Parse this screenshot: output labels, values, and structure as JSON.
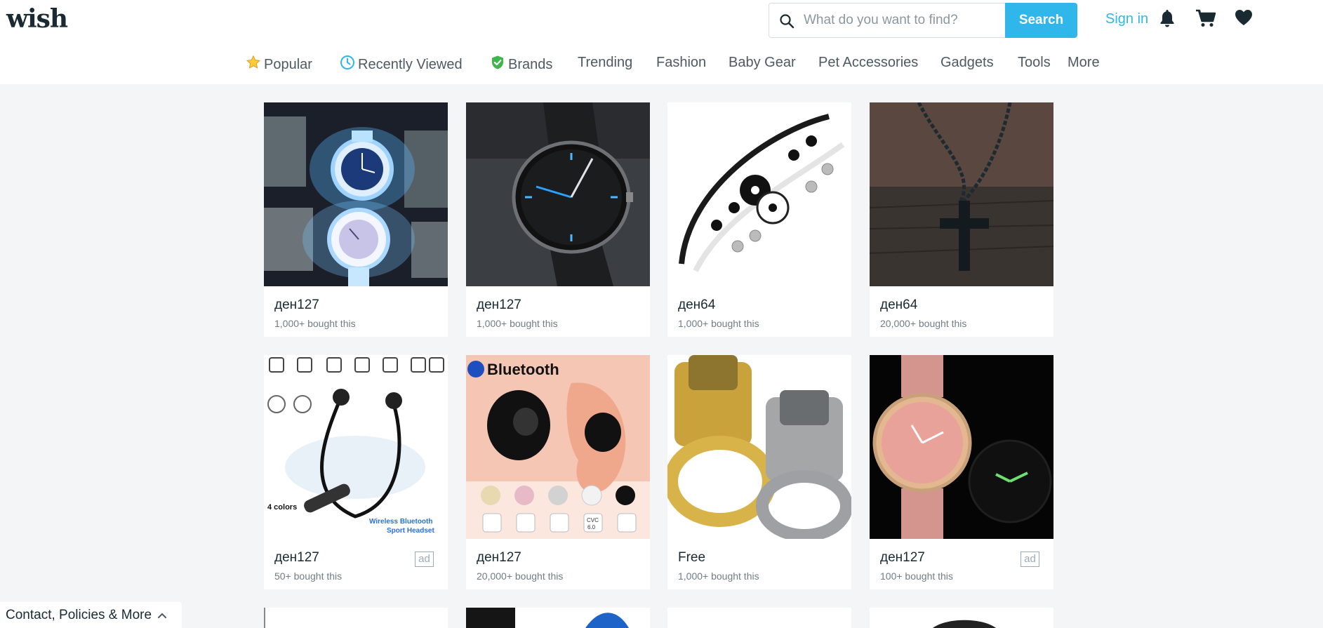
{
  "header": {
    "logo": "wish",
    "search_placeholder": "What do you want to find?",
    "search_button": "Search",
    "sign_in": "Sign in",
    "icons": [
      "bell-icon",
      "cart-icon",
      "heart-icon"
    ]
  },
  "nav": {
    "items": [
      {
        "label": "Popular",
        "icon": "star-icon"
      },
      {
        "label": "Recently Viewed",
        "icon": "clock-icon"
      },
      {
        "label": "Brands",
        "icon": "shield-check-icon"
      },
      {
        "label": "Trending"
      },
      {
        "label": "Fashion"
      },
      {
        "label": "Baby Gear"
      },
      {
        "label": "Pet Accessories"
      },
      {
        "label": "Gadgets"
      },
      {
        "label": "Tools"
      },
      {
        "label": "More"
      }
    ]
  },
  "products": [
    {
      "price": "ден127",
      "bought": "1,000+ bought this",
      "ad": "",
      "image": "glowing-watches"
    },
    {
      "price": "ден127",
      "bought": "1,000+ bought this",
      "ad": "",
      "image": "black-mesh-watch"
    },
    {
      "price": "ден64",
      "bought": "1,000+ bought this",
      "ad": "",
      "image": "yin-yang-bracelets"
    },
    {
      "price": "ден64",
      "bought": "20,000+ bought this",
      "ad": "",
      "image": "cross-necklace"
    },
    {
      "price": "ден127",
      "bought": "50+ bought this",
      "ad": "ad",
      "image": "bluetooth-sport-headset"
    },
    {
      "price": "ден127",
      "bought": "20,000+ bought this",
      "ad": "",
      "image": "bluetooth-earbud"
    },
    {
      "price": "Free",
      "bought": "1,000+ bought this",
      "ad": "",
      "image": "lighter-rings"
    },
    {
      "price": "ден127",
      "bought": "100+ bought this",
      "ad": "ad",
      "image": "pink-watch"
    }
  ],
  "product_image_text": {
    "bluetooth": "Bluetooth",
    "colors": "4 colors",
    "headset_line1": "Wireless Bluetooth",
    "headset_line2": "Sport Headset",
    "cvc": "CVC",
    "cvc_version": "6.0"
  },
  "footer": {
    "label": "Contact, Policies & More"
  },
  "colors": {
    "accent": "#2fb7ec",
    "text": "#192a32",
    "background": "#f3f5f7"
  }
}
